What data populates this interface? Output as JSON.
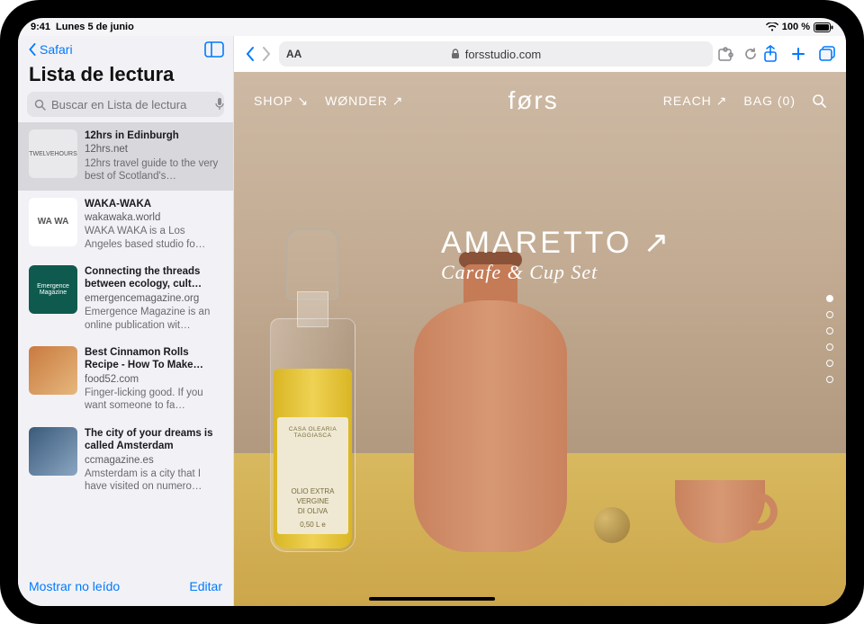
{
  "status": {
    "time": "9:41",
    "date": "Lunes 5 de junio",
    "battery": "100 %"
  },
  "sidebar": {
    "back_label": "Safari",
    "title": "Lista de lectura",
    "search_placeholder": "Buscar en Lista de lectura",
    "items": [
      {
        "title": "12hrs in Edinburgh",
        "site": "12hrs.net",
        "desc": "12hrs travel guide to the very best of Scotland's…",
        "thumb_label": "TWELVEHOURS"
      },
      {
        "title": "WAKA-WAKA",
        "site": "wakawaka.world",
        "desc": "WAKA WAKA is a Los Angeles based studio fo…",
        "thumb_label": "WA WA"
      },
      {
        "title": "Connecting the threads between ecology, cult…",
        "site": "emergencemagazine.org",
        "desc": "Emergence Magazine is an online publication wit…",
        "thumb_label": "Emergence Magazine"
      },
      {
        "title": "Best Cinnamon Rolls Recipe - How To Make…",
        "site": "food52.com",
        "desc": "Finger-licking good. If you want someone to fa…",
        "thumb_label": ""
      },
      {
        "title": "The city of your dreams is called Amsterdam",
        "site": "ccmagazine.es",
        "desc": "Amsterdam is a city that I have visited on numero…",
        "thumb_label": ""
      }
    ],
    "footer_left": "Mostrar no leído",
    "footer_right": "Editar"
  },
  "browser": {
    "url": "forsstudio.com",
    "aa_label": "AA"
  },
  "page": {
    "nav": {
      "shop": "SHOP",
      "wonder": "WØNDER",
      "logo": "førs",
      "reach": "REACH",
      "bag": "BAG (0)"
    },
    "hero": {
      "title": "AMARETTO",
      "subtitle": "Carafe & Cup Set"
    },
    "bottle_label": {
      "brand": "CASA OLEARIA TAGGIASCA",
      "line1": "OLIO EXTRA",
      "line2": "VERGINE",
      "line3": "DI OLIVA",
      "size": "0,50 L e"
    },
    "dot_count": 6,
    "active_dot": 0
  }
}
